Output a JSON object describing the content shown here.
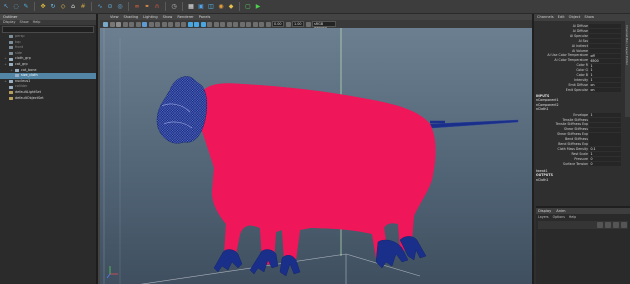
{
  "shelf": {
    "tools": [
      {
        "icon": "select-arrow-icon",
        "color": "#5fb0e8",
        "glyph": "↖"
      },
      {
        "icon": "lasso-icon",
        "color": "#6cc3f0",
        "glyph": "◌"
      },
      {
        "icon": "paint-select-icon",
        "color": "#4db4e0",
        "glyph": "✎"
      },
      {
        "icon": "move-icon",
        "color": "#e0c040",
        "glyph": "✥"
      },
      {
        "icon": "rotate-icon",
        "color": "#69c2ec",
        "glyph": "↻"
      },
      {
        "icon": "scale-icon",
        "color": "#f0c54a",
        "glyph": "◇"
      },
      {
        "icon": "bone-icon",
        "color": "#e5e5e5",
        "glyph": "⌂"
      },
      {
        "icon": "snap-grid-icon",
        "color": "#c8a040",
        "glyph": "#"
      },
      {
        "icon": "snap-curve-icon",
        "color": "#58a8d8",
        "glyph": "∿"
      },
      {
        "icon": "snap-point-icon",
        "color": "#68b8e8",
        "glyph": "⊙"
      },
      {
        "icon": "snap-surface-icon",
        "color": "#6ab0e0",
        "glyph": "◎"
      },
      {
        "icon": "link-icon",
        "color": "#ff6a3d",
        "glyph": "∞"
      },
      {
        "icon": "unlink-icon",
        "color": "#ffa04a",
        "glyph": "⚭"
      },
      {
        "icon": "magnet-icon",
        "color": "#e85a4a",
        "glyph": "∩"
      },
      {
        "icon": "history-icon",
        "color": "#c0c0c0",
        "glyph": "◷"
      },
      {
        "icon": "render-clapper-icon",
        "color": "#e6e6e6",
        "glyph": "▦"
      },
      {
        "icon": "render-icon",
        "color": "#4ea4e8",
        "glyph": "▣"
      },
      {
        "icon": "ipr-render-icon",
        "color": "#56c8ff",
        "glyph": "◫"
      },
      {
        "icon": "hypershade-icon",
        "color": "#e8a23c",
        "glyph": "◉"
      },
      {
        "icon": "arnold-icon",
        "color": "#e8c24a",
        "glyph": "◆"
      },
      {
        "icon": "ipr-stop-icon",
        "color": "#5fd060",
        "glyph": "▢"
      },
      {
        "icon": "play-icon",
        "color": "#4dd24d",
        "glyph": "▶"
      }
    ]
  },
  "outliner": {
    "title": "Outliner",
    "menu": [
      "Display",
      "Show",
      "Help"
    ],
    "items": [
      {
        "label": "persp",
        "indent": 2,
        "icon": "camera-icon",
        "dim": true,
        "selected": false,
        "expander": ""
      },
      {
        "label": "top",
        "indent": 2,
        "icon": "camera-icon",
        "dim": true,
        "selected": false,
        "expander": ""
      },
      {
        "label": "front",
        "indent": 2,
        "icon": "camera-icon",
        "dim": true,
        "selected": false,
        "expander": ""
      },
      {
        "label": "side",
        "indent": 2,
        "icon": "camera-icon",
        "dim": true,
        "selected": false,
        "expander": ""
      },
      {
        "label": "cloth_grp",
        "indent": 2,
        "icon": "transform-icon",
        "dim": false,
        "selected": false,
        "expander": "+"
      },
      {
        "label": "cat_grp",
        "indent": 2,
        "icon": "transform-icon",
        "dim": false,
        "selected": false,
        "expander": "+"
      },
      {
        "label": "cat_bone",
        "indent": 5,
        "icon": "transform-icon",
        "dim": false,
        "selected": false,
        "expander": "+"
      },
      {
        "label": "size_cloth",
        "indent": 5,
        "icon": "mesh-icon",
        "dim": false,
        "selected": true,
        "expander": ""
      },
      {
        "label": "nucleus1",
        "indent": 2,
        "icon": "transform-icon",
        "dim": false,
        "selected": false,
        "expander": "+"
      },
      {
        "label": "collider",
        "indent": 2,
        "icon": "transform-icon",
        "dim": true,
        "selected": false,
        "expander": ""
      },
      {
        "label": "defaultLightSet",
        "indent": 2,
        "icon": "set-icon",
        "dim": false,
        "selected": false,
        "expander": ""
      },
      {
        "label": "defaultObjectSet",
        "indent": 2,
        "icon": "set-icon",
        "dim": false,
        "selected": false,
        "expander": ""
      }
    ]
  },
  "viewport": {
    "menu": [
      "View",
      "Shading",
      "Lighting",
      "Show",
      "Renderer",
      "Panels"
    ],
    "field_near": "0.00",
    "field_far": "1.00",
    "colorspace": "sRGB gamma",
    "cloth_color": "#f0165a",
    "rig_color": "#1a2f8a"
  },
  "channelbox": {
    "tabs": [
      "Channels",
      "Edit",
      "Object",
      "Show"
    ],
    "side_tab": "Channel Box / Layer Editor",
    "attrs_top": [
      {
        "name": "Ai Diffuse",
        "value": ""
      },
      {
        "name": "Ai Diffuse",
        "value": ""
      },
      {
        "name": "Ai Specular",
        "value": ""
      },
      {
        "name": "Ai Sss",
        "value": ""
      },
      {
        "name": "Ai Indirect",
        "value": ""
      },
      {
        "name": "Ai Volume",
        "value": ""
      },
      {
        "name": "Ai Use Color Temperature",
        "value": "off"
      },
      {
        "name": "Ai Color Temperature",
        "value": "6500"
      },
      {
        "name": "Color R",
        "value": "1"
      },
      {
        "name": "Color G",
        "value": "1"
      },
      {
        "name": "Color B",
        "value": "1"
      },
      {
        "name": "Intensity",
        "value": "1"
      },
      {
        "name": "Emit Diffuse",
        "value": "on"
      },
      {
        "name": "Emit Specular",
        "value": "on"
      }
    ],
    "inputs_label": "INPUTS",
    "inputs": [
      "nComponent1",
      "nComponent2",
      "nCloth1"
    ],
    "attrs_mid": [
      {
        "name": "Envelope",
        "value": "1"
      },
      {
        "name": "Tensile Stiffness",
        "value": ""
      },
      {
        "name": "Tensile Stiffness Exp",
        "value": ""
      },
      {
        "name": "Shear Stiffness",
        "value": ""
      },
      {
        "name": "Shear Stiffness Exp",
        "value": ""
      },
      {
        "name": "Bend Stiffness",
        "value": ""
      },
      {
        "name": "Bend Stiffness Exp",
        "value": ""
      },
      {
        "name": "Cloth Mass Density",
        "value": "0.1"
      },
      {
        "name": "Rest Scale",
        "value": "1"
      },
      {
        "name": "Pressure",
        "value": "0"
      },
      {
        "name": "Surface Tension",
        "value": "0"
      }
    ],
    "tweak_label": "tweak1",
    "outputs_label": "OUTPUTS",
    "outputs": [
      "nCloth1"
    ]
  },
  "display_panel": {
    "tabs": [
      "Display",
      "Anim"
    ],
    "menu": [
      "Layers",
      "Options",
      "Help"
    ]
  }
}
